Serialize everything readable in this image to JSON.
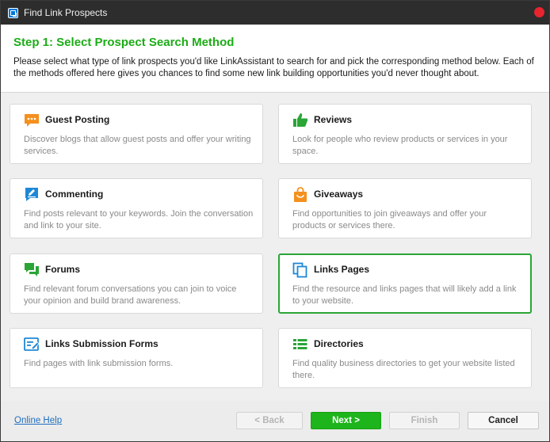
{
  "window": {
    "title": "Find Link Prospects"
  },
  "header": {
    "step_title": "Step 1: Select Prospect Search Method",
    "description": "Please select what type of link prospects you'd like LinkAssistant to search for and pick the corresponding method below. Each of the methods offered here gives you chances to find some new link building opportunities you'd never thought about."
  },
  "methods": [
    {
      "title": "Guest Posting",
      "description": "Discover blogs that allow guest posts and offer your writing services.",
      "icon": "speech-bubble-icon",
      "icon_color": "#f5901e"
    },
    {
      "title": "Reviews",
      "description": "Look for people who review products or services in your space.",
      "icon": "thumbs-up-icon",
      "icon_color": "#2aa536"
    },
    {
      "title": "Commenting",
      "description": "Find posts relevant to your keywords. Join the conversation and link to your site.",
      "icon": "pencil-comment-icon",
      "icon_color": "#1e88d6"
    },
    {
      "title": "Giveaways",
      "description": "Find opportunities to join giveaways and offer your products or services there.",
      "icon": "shopping-bag-icon",
      "icon_color": "#f5901e"
    },
    {
      "title": "Forums",
      "description": "Find relevant forum conversations you can join to voice your opinion and build brand awareness.",
      "icon": "forum-bubbles-icon",
      "icon_color": "#2aa536"
    },
    {
      "title": "Links Pages",
      "description": "Find the resource and links pages that will likely add a link to your website.",
      "icon": "copy-pages-icon",
      "icon_color": "#1e88d6"
    },
    {
      "title": "Links Submission Forms",
      "description": "Find pages with link submission forms.",
      "icon": "form-edit-icon",
      "icon_color": "#1e88d6"
    },
    {
      "title": "Directories",
      "description": "Find quality business directories to get your website listed there.",
      "icon": "list-icon",
      "icon_color": "#2aa536"
    }
  ],
  "selected_method": "Links Pages",
  "footer": {
    "help_label": "Online Help",
    "back_label": "< Back",
    "next_label": "Next >",
    "finish_label": "Finish",
    "cancel_label": "Cancel"
  },
  "colors": {
    "accent_green": "#1cac16",
    "selected_border": "#2aa536",
    "link_blue": "#1f6fbf"
  }
}
